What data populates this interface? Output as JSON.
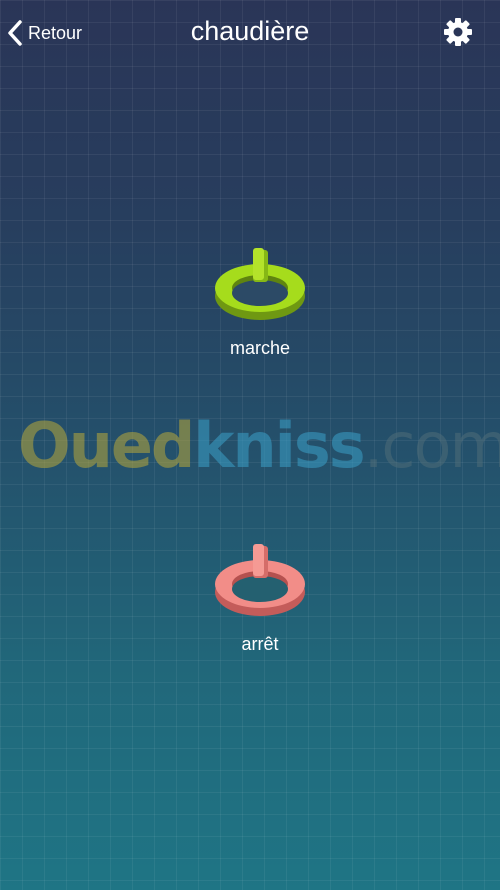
{
  "header": {
    "back_label": "Retour",
    "title": "chaudière",
    "settings_icon": "gear-icon"
  },
  "controls": {
    "on": {
      "label": "marche",
      "icon": "power-icon",
      "color": "#9fd61a"
    },
    "off": {
      "label": "arrêt",
      "icon": "power-icon",
      "color": "#f08a86"
    }
  },
  "watermark": {
    "part1": "Oued",
    "part2": "kniss",
    "part3": ".com",
    "colors": [
      "#b8a83a",
      "#3aa0c8",
      "#4f6d78"
    ]
  },
  "theme": {
    "bg_top": "#2a3557",
    "bg_bottom": "#1f7585",
    "text": "#ffffff"
  }
}
